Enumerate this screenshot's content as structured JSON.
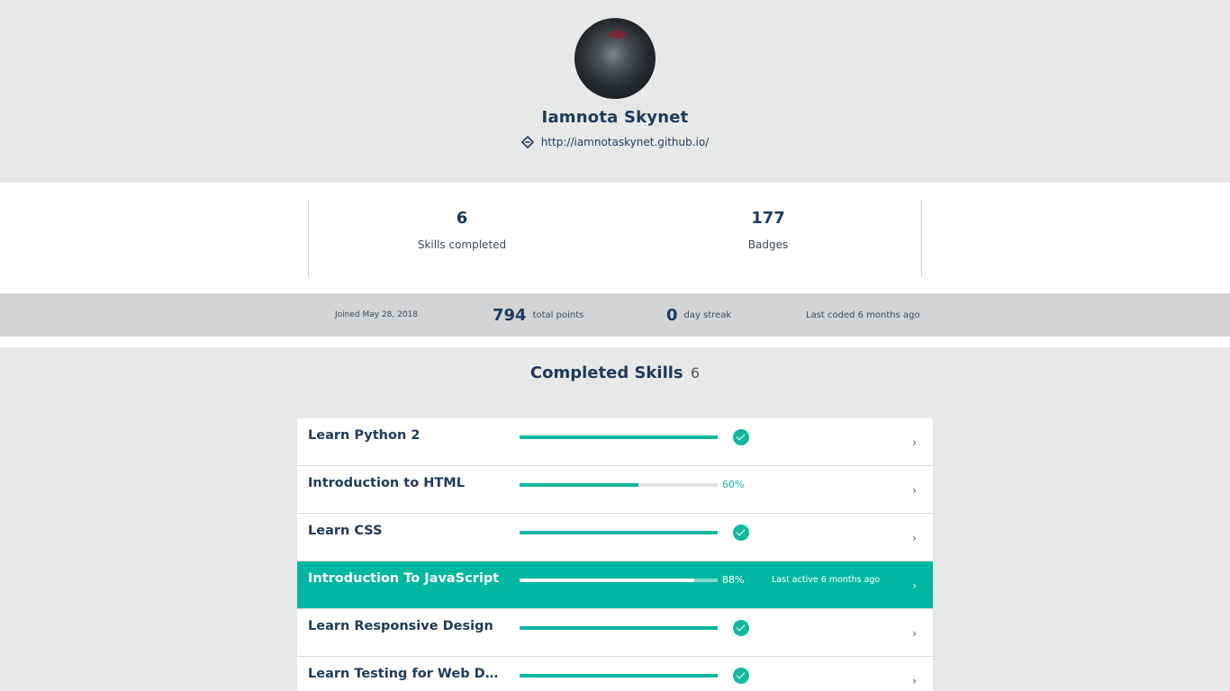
{
  "profile": {
    "name": "Iamnota Skynet",
    "link": "http://iamnotaskynet.github.io/",
    "avatar": "user-avatar-photo"
  },
  "stats": [
    {
      "value": "6",
      "label": "Skills completed"
    },
    {
      "value": "177",
      "label": "Badges"
    }
  ],
  "meta": {
    "joined": "Joined May 28, 2018",
    "points_value": "794",
    "points_label": "total points",
    "streak_value": "0",
    "streak_label": "day streak",
    "last_coded": "Last coded 6 months ago"
  },
  "skills_section": {
    "title": "Completed Skills",
    "count": "6"
  },
  "skills": [
    {
      "name": "Learn Python 2",
      "progress": 1.0,
      "completed": true,
      "percent_label": "",
      "last_active": "",
      "active": false
    },
    {
      "name": "Introduction to HTML",
      "progress": 0.6,
      "completed": false,
      "percent_label": "60%",
      "last_active": "",
      "active": false
    },
    {
      "name": "Learn CSS",
      "progress": 1.0,
      "completed": true,
      "percent_label": "",
      "last_active": "",
      "active": false
    },
    {
      "name": "Introduction To JavaScript",
      "progress": 0.88,
      "completed": false,
      "percent_label": "88%",
      "last_active": "Last active 6 months ago",
      "active": true
    },
    {
      "name": "Learn Responsive Design",
      "progress": 1.0,
      "completed": true,
      "percent_label": "",
      "last_active": "",
      "active": false
    },
    {
      "name": "Learn Testing for Web Devel...",
      "progress": 1.0,
      "completed": true,
      "percent_label": "",
      "last_active": "",
      "active": false
    }
  ],
  "icons": {
    "link": "link-icon",
    "check": "check-circle-icon",
    "chevron": "chevron-right-icon",
    "chevron_glyph": "›"
  },
  "colors": {
    "accent": "#02b7a2",
    "text": "#1d3b5a",
    "background": "#e7e8e8",
    "meta_bar": "#d3d4d5"
  }
}
